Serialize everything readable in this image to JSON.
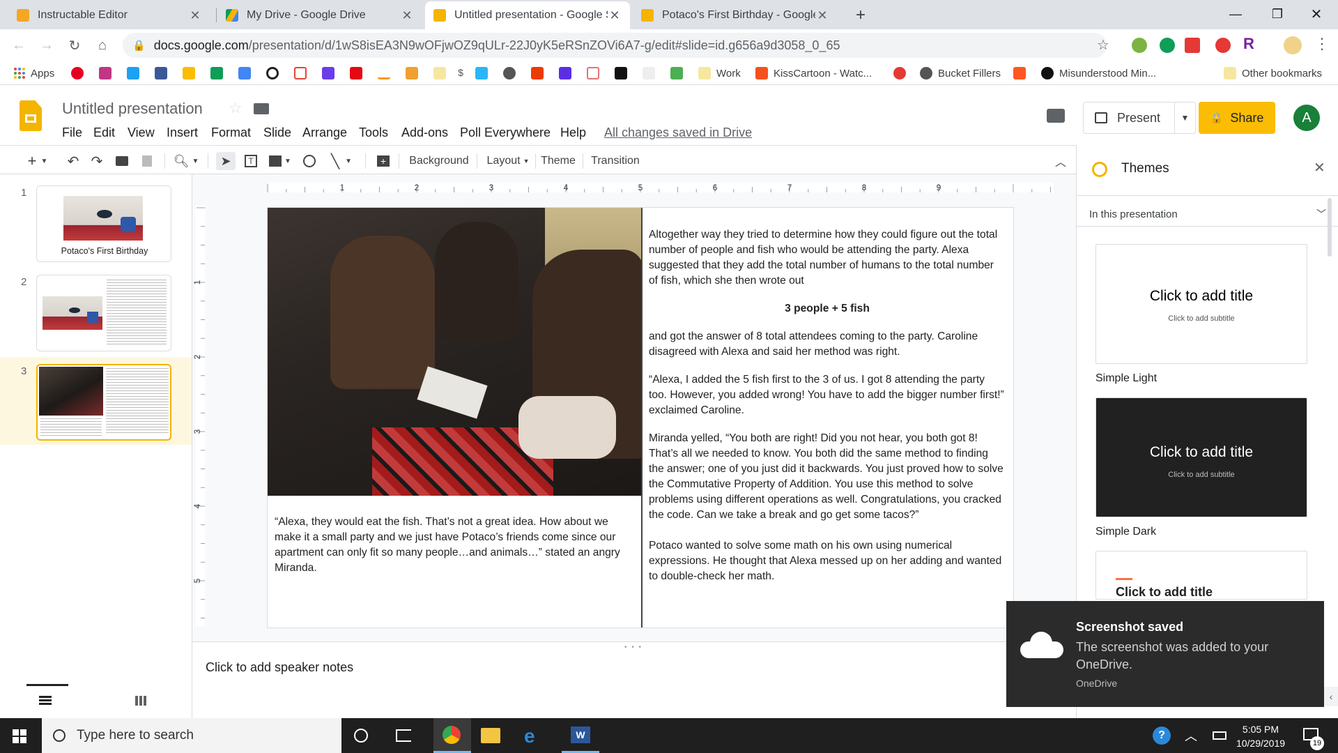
{
  "tabs": [
    {
      "title": "Instructable Editor",
      "color": "#f5a623"
    },
    {
      "title": "My Drive - Google Drive",
      "color": "#1fa463"
    },
    {
      "title": "Untitled presentation - Google Sl",
      "color": "#f4b400"
    },
    {
      "title": "Potaco's First Birthday - Google S",
      "color": "#f4b400"
    }
  ],
  "url": {
    "domain": "docs.google.com",
    "path": "/presentation/d/1wS8isEA3N9wOFjwOZ9qULr-22J0yK5eRSnZOVi6A7-g/edit#slide=id.g656a9d3058_0_65"
  },
  "bookmarks": {
    "apps": "Apps",
    "items": [
      "Work",
      "KissCartoon - Watc...",
      "Bucket Fillers",
      "Misunderstood Min...",
      "Other bookmarks"
    ]
  },
  "doc": {
    "title": "Untitled presentation",
    "menu": [
      "File",
      "Edit",
      "View",
      "Insert",
      "Format",
      "Slide",
      "Arrange",
      "Tools",
      "Add-ons",
      "Poll Everywhere",
      "Help"
    ],
    "saved": "All changes saved in Drive",
    "present": "Present",
    "share": "Share",
    "avatar": "A"
  },
  "toolbar": {
    "background": "Background",
    "layout": "Layout",
    "theme": "Theme",
    "transition": "Transition"
  },
  "ruler_numbers": [
    "1",
    "2",
    "3",
    "4",
    "5",
    "6",
    "7",
    "8",
    "9"
  ],
  "vruler_numbers": [
    "1",
    "2",
    "3",
    "4",
    "5"
  ],
  "filmstrip": [
    {
      "num": "1",
      "caption": "Potaco's First Birthday"
    },
    {
      "num": "2",
      "caption": ""
    },
    {
      "num": "3",
      "caption": ""
    }
  ],
  "slide": {
    "left_text": "“Alexa, they would eat the fish. That’s not a great idea. How about we make it a small party and we just have Potaco’s friends come since our apartment can only fit so many people…and animals…” stated an angry Miranda.",
    "p1": "Altogether way they tried to determine how they could figure out the total number of people and fish who would be attending the party. Alexa suggested that they add the total number of humans to the total number of fish, which she then wrote out",
    "equation": "3 people + 5 fish",
    "p2": "and got the answer of 8 total attendees coming to the party. Caroline disagreed with Alexa and said her method was right.",
    "p3": "“Alexa, I added the 5 fish first to the 3 of us. I got 8 attending the party too. However, you added wrong! You have to add the bigger number first!” exclaimed Caroline.",
    "p4": "Miranda yelled, “You both are right! Did you not hear, you both got 8! That’s all we needed to know. You both did the same method to finding the answer; one of you just did it backwards. You just proved how to solve the Commutative Property of Addition. You use this method to solve problems using different operations as well. Congratulations, you cracked the code. Can we take a break and go get some tacos?”",
    "p5": "Potaco wanted to solve some math on his own using numerical expressions. He thought that Alexa messed up on her adding and wanted to double-check her math."
  },
  "notes_placeholder": "Click to add speaker notes",
  "themes": {
    "title": "Themes",
    "filter": "In this presentation",
    "card_title": "Click to add title",
    "card_subtitle": "Click to add subtitle",
    "names": [
      "Simple Light",
      "Simple Dark"
    ]
  },
  "toast": {
    "title": "Screenshot saved",
    "body": "The screenshot was added to your OneDrive.",
    "app": "OneDrive"
  },
  "taskbar": {
    "search": "Type here to search",
    "time": "5:05 PM",
    "date": "10/29/2019",
    "badge": "19"
  },
  "colors": {
    "slides_yellow": "#f4b400",
    "share_yellow": "#fbbc04",
    "avatar_green": "#188038",
    "accent_blue": "#1a73e8"
  }
}
